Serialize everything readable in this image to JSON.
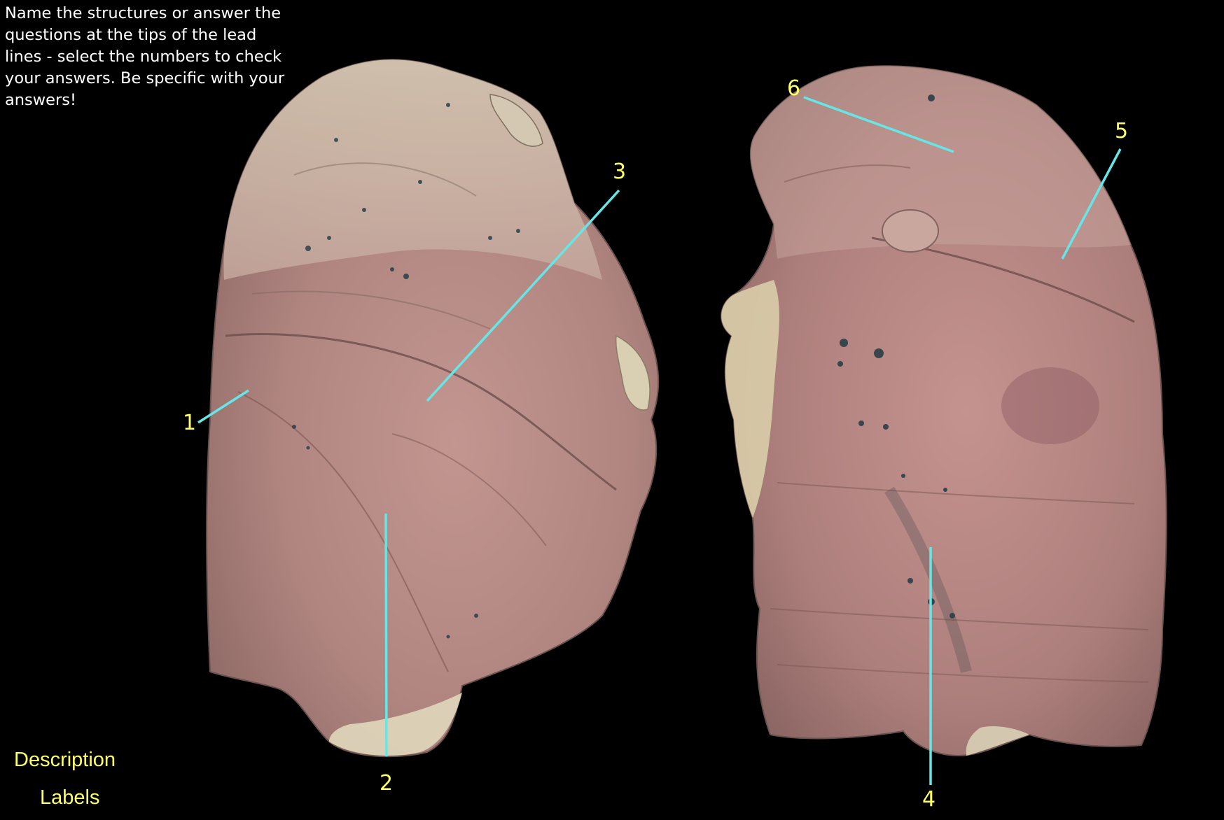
{
  "instructions": "Name the structures or answer the questions at the tips of the lead lines - select the numbers to check your answers. Be specific with your answers!",
  "links": {
    "description": "Description",
    "labels": "Labels"
  },
  "markers": [
    {
      "id": "1",
      "label": "1"
    },
    {
      "id": "2",
      "label": "2"
    },
    {
      "id": "3",
      "label": "3"
    },
    {
      "id": "4",
      "label": "4"
    },
    {
      "id": "5",
      "label": "5"
    },
    {
      "id": "6",
      "label": "6"
    }
  ],
  "colors": {
    "background": "#000000",
    "lead_line": "#66e6e6",
    "number_text": "#ffff66",
    "instruction_text": "#ffffff",
    "tissue_base": "#b88a86",
    "tissue_edge": "#e2d6b0"
  }
}
